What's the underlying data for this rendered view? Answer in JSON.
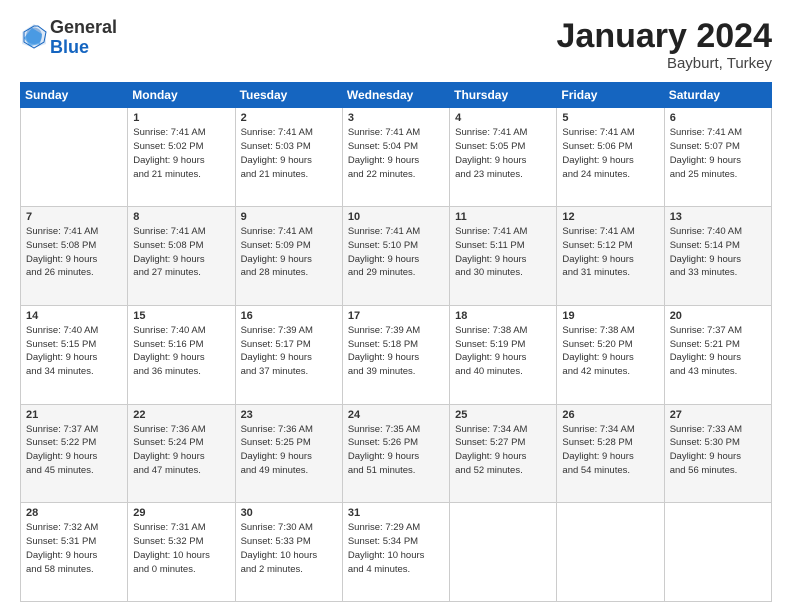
{
  "header": {
    "logo_general": "General",
    "logo_blue": "Blue",
    "month_title": "January 2024",
    "location": "Bayburt, Turkey"
  },
  "calendar": {
    "days_of_week": [
      "Sunday",
      "Monday",
      "Tuesday",
      "Wednesday",
      "Thursday",
      "Friday",
      "Saturday"
    ],
    "weeks": [
      [
        {
          "day": "",
          "info": ""
        },
        {
          "day": "1",
          "info": "Sunrise: 7:41 AM\nSunset: 5:02 PM\nDaylight: 9 hours\nand 21 minutes."
        },
        {
          "day": "2",
          "info": "Sunrise: 7:41 AM\nSunset: 5:03 PM\nDaylight: 9 hours\nand 21 minutes."
        },
        {
          "day": "3",
          "info": "Sunrise: 7:41 AM\nSunset: 5:04 PM\nDaylight: 9 hours\nand 22 minutes."
        },
        {
          "day": "4",
          "info": "Sunrise: 7:41 AM\nSunset: 5:05 PM\nDaylight: 9 hours\nand 23 minutes."
        },
        {
          "day": "5",
          "info": "Sunrise: 7:41 AM\nSunset: 5:06 PM\nDaylight: 9 hours\nand 24 minutes."
        },
        {
          "day": "6",
          "info": "Sunrise: 7:41 AM\nSunset: 5:07 PM\nDaylight: 9 hours\nand 25 minutes."
        }
      ],
      [
        {
          "day": "7",
          "info": "Sunrise: 7:41 AM\nSunset: 5:08 PM\nDaylight: 9 hours\nand 26 minutes."
        },
        {
          "day": "8",
          "info": "Sunrise: 7:41 AM\nSunset: 5:08 PM\nDaylight: 9 hours\nand 27 minutes."
        },
        {
          "day": "9",
          "info": "Sunrise: 7:41 AM\nSunset: 5:09 PM\nDaylight: 9 hours\nand 28 minutes."
        },
        {
          "day": "10",
          "info": "Sunrise: 7:41 AM\nSunset: 5:10 PM\nDaylight: 9 hours\nand 29 minutes."
        },
        {
          "day": "11",
          "info": "Sunrise: 7:41 AM\nSunset: 5:11 PM\nDaylight: 9 hours\nand 30 minutes."
        },
        {
          "day": "12",
          "info": "Sunrise: 7:41 AM\nSunset: 5:12 PM\nDaylight: 9 hours\nand 31 minutes."
        },
        {
          "day": "13",
          "info": "Sunrise: 7:40 AM\nSunset: 5:14 PM\nDaylight: 9 hours\nand 33 minutes."
        }
      ],
      [
        {
          "day": "14",
          "info": "Sunrise: 7:40 AM\nSunset: 5:15 PM\nDaylight: 9 hours\nand 34 minutes."
        },
        {
          "day": "15",
          "info": "Sunrise: 7:40 AM\nSunset: 5:16 PM\nDaylight: 9 hours\nand 36 minutes."
        },
        {
          "day": "16",
          "info": "Sunrise: 7:39 AM\nSunset: 5:17 PM\nDaylight: 9 hours\nand 37 minutes."
        },
        {
          "day": "17",
          "info": "Sunrise: 7:39 AM\nSunset: 5:18 PM\nDaylight: 9 hours\nand 39 minutes."
        },
        {
          "day": "18",
          "info": "Sunrise: 7:38 AM\nSunset: 5:19 PM\nDaylight: 9 hours\nand 40 minutes."
        },
        {
          "day": "19",
          "info": "Sunrise: 7:38 AM\nSunset: 5:20 PM\nDaylight: 9 hours\nand 42 minutes."
        },
        {
          "day": "20",
          "info": "Sunrise: 7:37 AM\nSunset: 5:21 PM\nDaylight: 9 hours\nand 43 minutes."
        }
      ],
      [
        {
          "day": "21",
          "info": "Sunrise: 7:37 AM\nSunset: 5:22 PM\nDaylight: 9 hours\nand 45 minutes."
        },
        {
          "day": "22",
          "info": "Sunrise: 7:36 AM\nSunset: 5:24 PM\nDaylight: 9 hours\nand 47 minutes."
        },
        {
          "day": "23",
          "info": "Sunrise: 7:36 AM\nSunset: 5:25 PM\nDaylight: 9 hours\nand 49 minutes."
        },
        {
          "day": "24",
          "info": "Sunrise: 7:35 AM\nSunset: 5:26 PM\nDaylight: 9 hours\nand 51 minutes."
        },
        {
          "day": "25",
          "info": "Sunrise: 7:34 AM\nSunset: 5:27 PM\nDaylight: 9 hours\nand 52 minutes."
        },
        {
          "day": "26",
          "info": "Sunrise: 7:34 AM\nSunset: 5:28 PM\nDaylight: 9 hours\nand 54 minutes."
        },
        {
          "day": "27",
          "info": "Sunrise: 7:33 AM\nSunset: 5:30 PM\nDaylight: 9 hours\nand 56 minutes."
        }
      ],
      [
        {
          "day": "28",
          "info": "Sunrise: 7:32 AM\nSunset: 5:31 PM\nDaylight: 9 hours\nand 58 minutes."
        },
        {
          "day": "29",
          "info": "Sunrise: 7:31 AM\nSunset: 5:32 PM\nDaylight: 10 hours\nand 0 minutes."
        },
        {
          "day": "30",
          "info": "Sunrise: 7:30 AM\nSunset: 5:33 PM\nDaylight: 10 hours\nand 2 minutes."
        },
        {
          "day": "31",
          "info": "Sunrise: 7:29 AM\nSunset: 5:34 PM\nDaylight: 10 hours\nand 4 minutes."
        },
        {
          "day": "",
          "info": ""
        },
        {
          "day": "",
          "info": ""
        },
        {
          "day": "",
          "info": ""
        }
      ]
    ]
  }
}
